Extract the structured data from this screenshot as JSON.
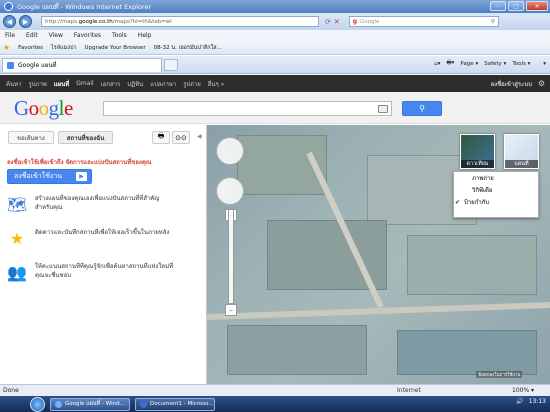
{
  "window": {
    "title": "Google แผนที่ - Windows Internet Explorer",
    "min": "–",
    "max": "□",
    "close": "×"
  },
  "address": {
    "back": "◀",
    "fwd": "▶",
    "url_prefix": "http://maps.",
    "url_domain": "google.co.th",
    "url_suffix": "/maps?hl=th&tab=wl",
    "search_placeholder": "Google"
  },
  "menu": [
    "File",
    "Edit",
    "View",
    "Favorites",
    "Tools",
    "Help"
  ],
  "favbar": {
    "favorites": "Favorites",
    "items": [
      "ไรส่แมงปา",
      "Upgrade Your Browser",
      "08-32 น. เยอรมันปาลีกใส..."
    ]
  },
  "tab": {
    "label": "Google แผนที่"
  },
  "cmdbar": {
    "page": "Page ▾",
    "safety": "Safety ▾",
    "tools": "Tools ▾",
    "help": "❔▾"
  },
  "gbar": {
    "items": [
      "ค้นหา",
      "รูปภาพ",
      "แผนที่",
      "Gmail",
      "เอกสาร",
      "ปฏิทิน",
      "แปลภาษา",
      "รูปถ่าย",
      "อื่นๆ »"
    ],
    "signin": "ลงชื่อเข้าสู่ระบบ"
  },
  "logo": [
    "G",
    "o",
    "o",
    "g",
    "l",
    "e"
  ],
  "panel": {
    "btn_directions": "ขอเส้นทาง",
    "btn_myplaces": "สถานที่ของฉัน",
    "print_icon": "🖶",
    "link_icon": "⊙⊙",
    "collapse": "◀",
    "title": "ลงชื่อเข้าใช้เพื่อเข้าถึง จัดการและแบ่งปันสถานที่ของคุณ",
    "signin_btn": "ลงชื่อเข้าใช้งาน",
    "signin_arrow": "▶",
    "features": [
      {
        "icon": "🗺",
        "text": "สร้างแผนที่ของคุณเองเพื่อแบ่งปันสถานที่ที่สำคัญสำหรับคุณ"
      },
      {
        "icon": "★",
        "text": "ติดดาวและบันทึกสถานที่เพื่อให้เจอเร็วขึ้นในภายหลัง"
      },
      {
        "icon": "👥",
        "text": "ให้คะแนนสถานที่ที่คุณรู้จักเพื่อค้นหาสถานที่แห่งใหม่ที่คุณจะชื่นชอบ"
      }
    ]
  },
  "map": {
    "type_satellite": "ดาวเทียม",
    "type_map": "แผนที่",
    "menu": {
      "terrain": "ภาพถ่าย",
      "wiki": "วิกิพีเดีย",
      "labels": "ป้ายกำกับ",
      "check": "✔"
    },
    "zoom_in": "+",
    "zoom_out": "–",
    "copyright": "ข้อตกลงในการใช้งาน"
  },
  "status": {
    "left": "Done",
    "zone": "Internet",
    "zoom": "100% ▾"
  },
  "taskbar": {
    "items": [
      "Google แผนที่ - Wind...",
      "Document1 - Microso..."
    ],
    "time": "13:13"
  }
}
